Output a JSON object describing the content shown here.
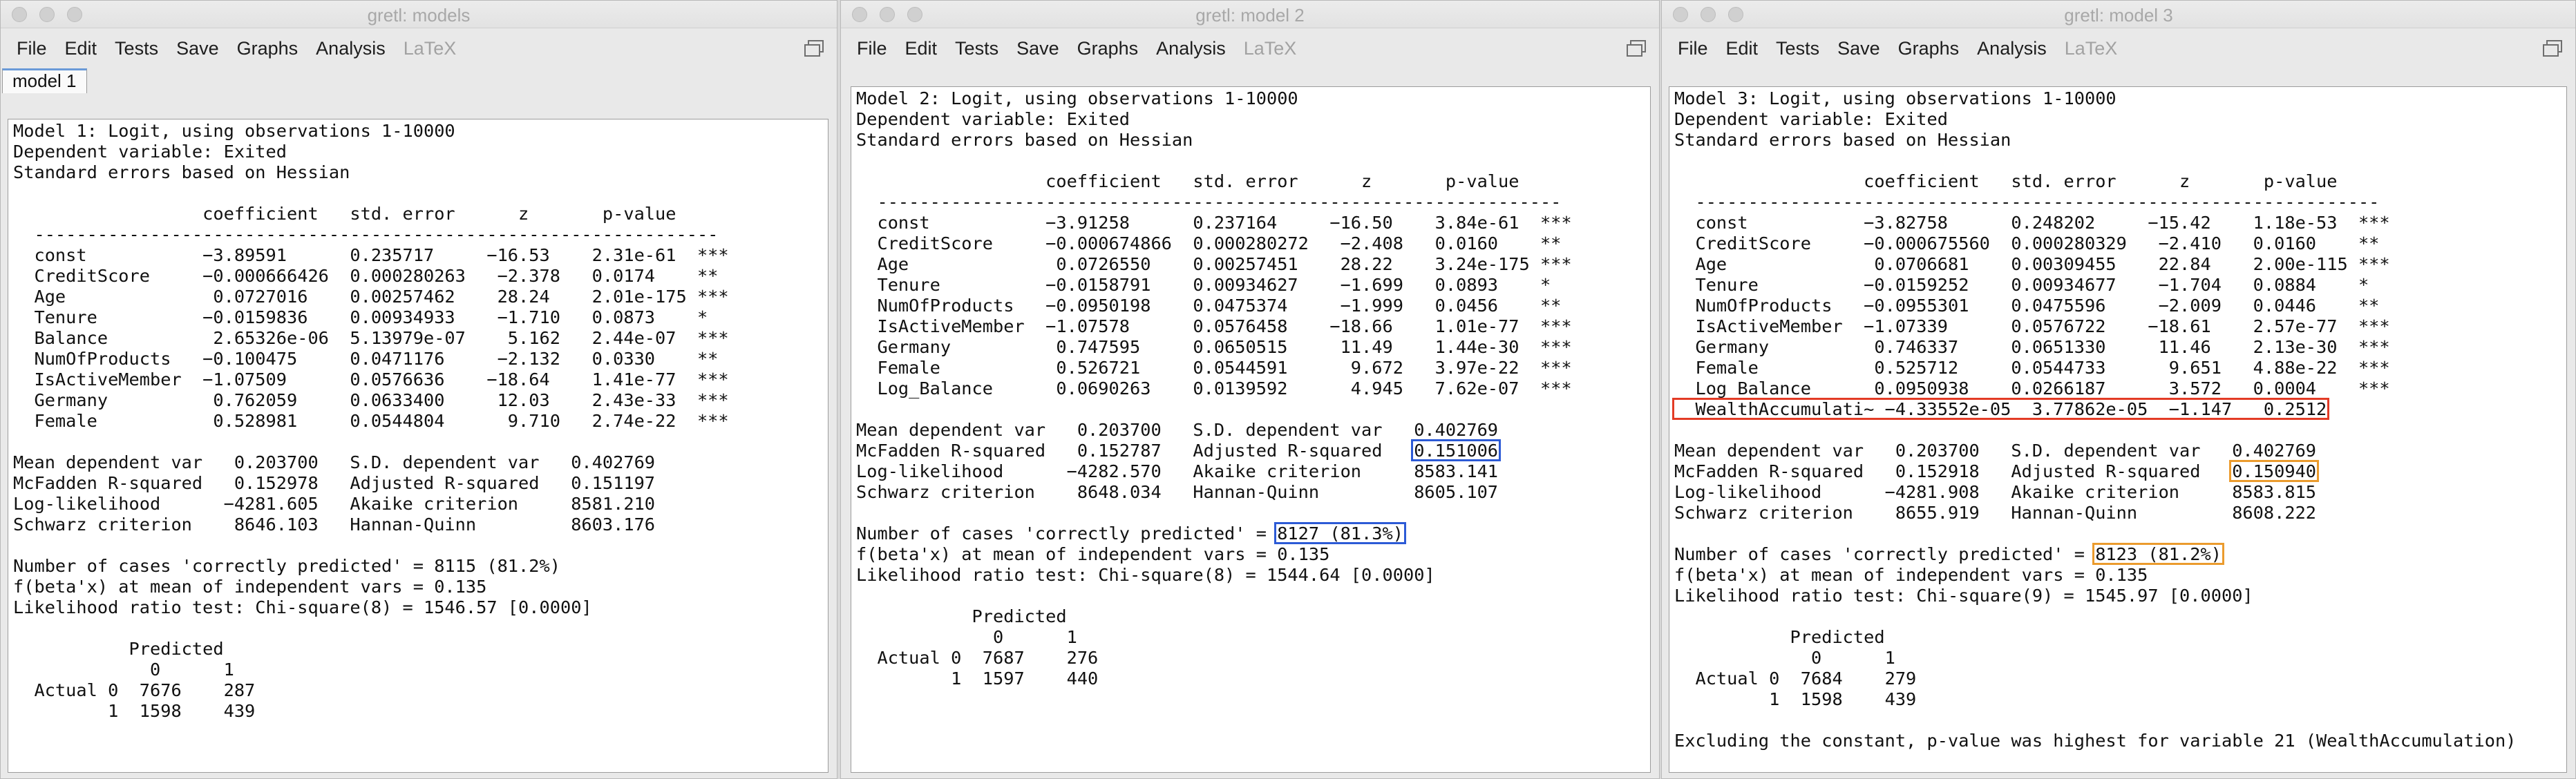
{
  "colors": {
    "highlight_blue": "#2c5ad6",
    "highlight_orange": "#eb9b2d",
    "highlight_red": "#e33b25"
  },
  "windows": [
    {
      "id": "w1",
      "title": "gretl: models",
      "menus": [
        "File",
        "Edit",
        "Tests",
        "Save",
        "Graphs",
        "Analysis",
        "LaTeX"
      ],
      "tab": "model 1",
      "lines": [
        "Model 1: Logit, using observations 1-10000",
        "Dependent variable: Exited",
        "Standard errors based on Hessian",
        "",
        "                  coefficient   std. error      z       p-value",
        "  -----------------------------------------------------------------",
        "  const           −3.89591      0.235717     −16.53    2.31e-61  ***",
        "  CreditScore     −0.000666426  0.000280263   −2.378   0.0174    **",
        "  Age              0.0727016    0.00257462    28.24    2.01e-175 ***",
        "  Tenure          −0.0159836    0.00934933    −1.710   0.0873    *",
        "  Balance          2.65326e-06  5.13979e-07    5.162   2.44e-07  ***",
        "  NumOfProducts   −0.100475     0.0471176     −2.132   0.0330    **",
        "  IsActiveMember  −1.07509      0.0576636    −18.64    1.41e-77  ***",
        "  Germany          0.762059     0.0633400     12.03    2.43e-33  ***",
        "  Female           0.528981     0.0544804      9.710   2.74e-22  ***",
        "",
        "Mean dependent var   0.203700   S.D. dependent var   0.402769",
        "McFadden R-squared   0.152978   Adjusted R-squared   0.151197",
        "Log-likelihood      −4281.605   Akaike criterion     8581.210",
        "Schwarz criterion    8646.103   Hannan-Quinn         8603.176",
        "",
        "Number of cases 'correctly predicted' = 8115 (81.2%)",
        "f(beta'x) at mean of independent vars = 0.135",
        "Likelihood ratio test: Chi-square(8) = 1546.57 [0.0000]",
        "",
        "           Predicted",
        "             0      1",
        "  Actual 0  7676    287",
        "         1  1598    439"
      ]
    },
    {
      "id": "w2",
      "title": "gretl: model 2",
      "menus": [
        "File",
        "Edit",
        "Tests",
        "Save",
        "Graphs",
        "Analysis",
        "LaTeX"
      ],
      "lines": [
        "Model 2: Logit, using observations 1-10000",
        "Dependent variable: Exited",
        "Standard errors based on Hessian",
        "",
        "                  coefficient   std. error      z       p-value",
        "  -----------------------------------------------------------------",
        "  const           −3.91258      0.237164     −16.50    3.84e-61  ***",
        "  CreditScore     −0.000674866  0.000280272   −2.408   0.0160    **",
        "  Age              0.0726550    0.00257451    28.22    3.24e-175 ***",
        "  Tenure          −0.0158791    0.00934627    −1.699   0.0893    *",
        "  NumOfProducts   −0.0950198    0.0475374     −1.999   0.0456    **",
        "  IsActiveMember  −1.07578      0.0576458    −18.66    1.01e-77  ***",
        "  Germany          0.747595     0.0650515     11.49    1.44e-30  ***",
        "  Female           0.526721     0.0544591      9.672   3.97e-22  ***",
        "  Log_Balance      0.0690263    0.0139592      4.945   7.62e-07  ***",
        "",
        "Mean dependent var   0.203700   S.D. dependent var   0.402769",
        "McFadden R-squared   0.152787   Adjusted R-squared   0.151006",
        "Log-likelihood      −4282.570   Akaike criterion     8583.141",
        "Schwarz criterion    8648.034   Hannan-Quinn         8605.107",
        "",
        "Number of cases 'correctly predicted' = 8127 (81.3%)",
        "f(beta'x) at mean of independent vars = 0.135",
        "Likelihood ratio test: Chi-square(8) = 1544.64 [0.0000]",
        "",
        "           Predicted",
        "             0      1",
        "  Actual 0  7687    276",
        "         1  1597    440"
      ]
    },
    {
      "id": "w3",
      "title": "gretl: model 3",
      "menus": [
        "File",
        "Edit",
        "Tests",
        "Save",
        "Graphs",
        "Analysis",
        "LaTeX"
      ],
      "lines": [
        "Model 3: Logit, using observations 1-10000",
        "Dependent variable: Exited",
        "Standard errors based on Hessian",
        "",
        "                  coefficient   std. error      z       p-value",
        "  -----------------------------------------------------------------",
        "  const           −3.82758      0.248202     −15.42    1.18e-53  ***",
        "  CreditScore     −0.000675560  0.000280329   −2.410   0.0160    **",
        "  Age              0.0706681    0.00309455    22.84    2.00e-115 ***",
        "  Tenure          −0.0159252    0.00934677    −1.704   0.0884    *",
        "  NumOfProducts   −0.0955301    0.0475596     −2.009   0.0446    **",
        "  IsActiveMember  −1.07339      0.0576722    −18.61    2.57e-77  ***",
        "  Germany          0.746337     0.0651330     11.46    2.13e-30  ***",
        "  Female           0.525712     0.0544733      9.651   4.88e-22  ***",
        "  Log_Balance      0.0950938    0.0266187      3.572   0.0004    ***",
        "  WealthAccumulati~ −4.33552e-05  3.77862e-05  −1.147   0.2512",
        "",
        "Mean dependent var   0.203700   S.D. dependent var   0.402769",
        "McFadden R-squared   0.152918   Adjusted R-squared   0.150940",
        "Log-likelihood      −4281.908   Akaike criterion     8583.815",
        "Schwarz criterion    8655.919   Hannan-Quinn         8608.222",
        "",
        "Number of cases 'correctly predicted' = 8123 (81.2%)",
        "f(beta'x) at mean of independent vars = 0.135",
        "Likelihood ratio test: Chi-square(9) = 1545.97 [0.0000]",
        "",
        "           Predicted",
        "             0      1",
        "  Actual 0  7684    279",
        "         1  1598    439",
        "",
        "Excluding the constant, p-value was highest for variable 21 (WealthAccumulation)"
      ]
    }
  ]
}
